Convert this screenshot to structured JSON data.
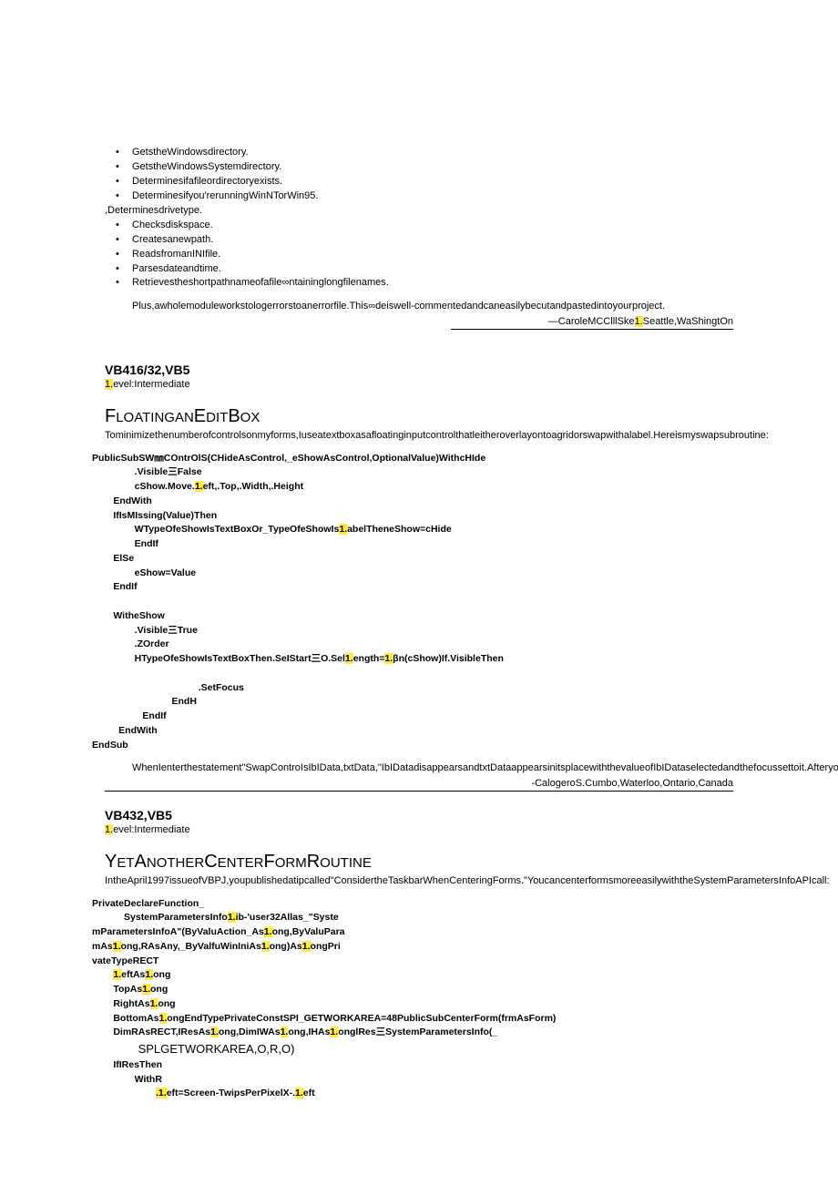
{
  "bullets_top": [
    "GetstheWindowsdirectory.",
    "GetstheWindowsSystemdirectory.",
    "Determinesifafileordirectoryexists.",
    "Determinesifyou'rerunningWinNTorWin95."
  ],
  "bullets_mid_nobul": ",Determinesdrivetype.",
  "bullets_bottom": [
    "Checksdiskspace.",
    "Createsanewpath.",
    "ReadsfromanINIfile.",
    "Parsesdateandtime.",
    "Retrievestheshortpathnameofafile∞ntaininglongfilenames."
  ],
  "para1": "Plus,awholemoduleworkstologerrorstoanerrorfile.This∞deiswell-commentedandcaneasilybecutandpastedintoyourproject.",
  "sig1_pre": "—CaroleMCClllSke",
  "sig1_hl": "1.",
  "sig1_post": "Seattle,WaShingtOn",
  "sec1_title": "VB416/32,VB5",
  "sec1_level_hl": "1.",
  "sec1_level_rest": "evel:Intermediate",
  "sec1_head": {
    "p": [
      {
        "t": "big",
        "v": "F"
      },
      {
        "t": "small",
        "v": "LOATINGAN"
      },
      {
        "t": "big",
        "v": "E"
      },
      {
        "t": "small",
        "v": "DIT"
      },
      {
        "t": "big",
        "v": "B"
      },
      {
        "t": "small",
        "v": "OX"
      }
    ]
  },
  "sec1_intro": "Tominimizethenumberofcontrolsonmyforms,Iuseatextboxasafloatinginputcontrolthatleitheroverlayontoagridorswapwithalabel.Hereismyswapsubroutine:",
  "sec1_code_pre": "PublicSubSW㎜COntrOlS(CHideAsControl,_eShowAsControl,OptionalValue)WithcHIde\n                .Visible三False\n                cShow.Move.",
  "sec1_code_hl1": "1.",
  "sec1_code_mid1": "eft,.Top,.Width,.Height\n        EndWith\n        IfIsMIssing(Value)Then\n                WTypeOfeShowIsTextBoxOr_TypeOfeShowIs",
  "sec1_code_hl2": "1.",
  "sec1_code_mid2": "abelTheneShow=cHide\n                EndIf\n        ElSe\n                eShow=Value\n        EndIf\n\n        WitheShow\n                .Visible三True\n                .ZOrder\n                HTypeOfeShowIsTextBoxThen.SeIStart三O.Sel",
  "sec1_code_hl3": "1.",
  "sec1_code_mid3": "ength=",
  "sec1_code_hl4": "1.",
  "sec1_code_mid4": "βn(cShow)If.VisibleThen\n\n                                        .SetFocus\n                              EndH\n                   EndIf\n          EndWith\nEndSub",
  "sec1_para2": "WhenIenterthestatement\"SwapControIsIbIData,txtData,\"IbIDatadisappearsandtxtDataappearsinitsplacewiththevalueofIbIDataselectedandthefocussettoit.Afteryoumakeyourentry,executethestatement\"SwapControlstxtData,IbIData.\"",
  "sig2": "-CalogeroS.Cumbo,Waterloo,Ontario,Canada",
  "sec2_title": "VB432,VB5",
  "sec2_level_hl": "1.",
  "sec2_level_rest": "evel:Intermediate",
  "sec2_head": {
    "p": [
      {
        "t": "big",
        "v": "Y"
      },
      {
        "t": "small",
        "v": "ET"
      },
      {
        "t": "big",
        "v": "A"
      },
      {
        "t": "small",
        "v": "NOTHER"
      },
      {
        "t": "big",
        "v": "C"
      },
      {
        "t": "small",
        "v": "ENTER"
      },
      {
        "t": "big",
        "v": "F"
      },
      {
        "t": "small",
        "v": "ORM"
      },
      {
        "t": "big",
        "v": "R"
      },
      {
        "t": "small",
        "v": "OUTINE"
      }
    ]
  },
  "sec2_intro": "IntheApril1997issueofVBPJ,youpublishedatipcalled\"ConsidertheTaskbarWhenCenteringForms.\"YoucancenterformsmoreeasilywiththeSystemParametersInfoAPIcall:",
  "code2": {
    "a": "PrivateDeclareFunction_\n            SystemParametersInfo",
    "a_hl": "1.",
    "b": "ib-'user32Allas_\"Syste\nmParametersInfoA\"(ByValuAction_As",
    "b_hl": "1.",
    "c": "ong,ByValuPara\nmAs",
    "c_hl": "1.",
    "d": "ong,RAsAny,_ByValfuWinIniAs",
    "d_hl": "1.",
    "e": "ong)As",
    "e_hl": "1.",
    "f": "ongPri\nvateTypeRECT\n        ",
    "f_hl": "1.",
    "g": "eftAs",
    "g_hl": "1.",
    "h": "ong\n        TopAs",
    "h_hl": "1.",
    "i": "ong\n        RightAs",
    "i_hl": "1.",
    "j": "ong\n        BottomAs",
    "j_hl": "1.",
    "k": "ongEndTypePrivateConstSPI_GETWORKAREA=48PublicSubCenterForm(frmAsForm)\n        DimRAsRECT,IResAs",
    "k_hl": "1.",
    "l": "ong,DimIWAs",
    "l_hl": "1.",
    "m": "ong,IHAs",
    "m_hl": "1.",
    "n": "onglRes三SystemParametersInfo(_",
    "sp": "              SPLGETWORKAREA,O,R,O)",
    "o": "\n        IfIResThen\n                WithR\n                        ",
    "o_hl": ".1.",
    "p": "eft=Screen-TwipsPerPixelX-.",
    "p_hl": "1.",
    "q": "eft"
  }
}
